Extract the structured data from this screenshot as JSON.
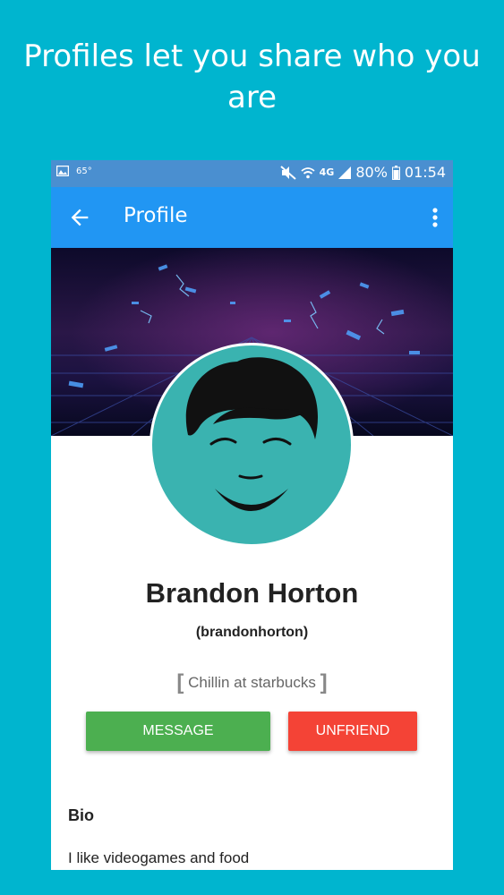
{
  "headline": "Profiles let you share who you are",
  "statusbar": {
    "temperature": "65°",
    "battery": "80%",
    "time": "01:54",
    "network": "4G"
  },
  "appbar": {
    "title": "Profile"
  },
  "profile": {
    "name": "Brandon Horton",
    "username": "(brandonhorton)",
    "status": "Chillin at starbucks",
    "status_open": "[",
    "status_close": "]"
  },
  "actions": {
    "message_label": "MESSAGE",
    "unfriend_label": "UNFRIEND"
  },
  "bio": {
    "heading": "Bio",
    "text": "I like videogames and food"
  },
  "colors": {
    "background": "#00b5cf",
    "appbar": "#2196f3",
    "statusbar": "#4a8fd0",
    "message": "#4caf50",
    "unfriend": "#f44336",
    "avatar": "#3ab3b0"
  },
  "icons": {
    "back": "arrow-left-icon",
    "more": "more-vert-icon",
    "gallery": "gallery-icon",
    "mute": "mute-icon",
    "wifi": "wifi-icon",
    "signal": "signal-icon",
    "battery": "battery-icon"
  }
}
